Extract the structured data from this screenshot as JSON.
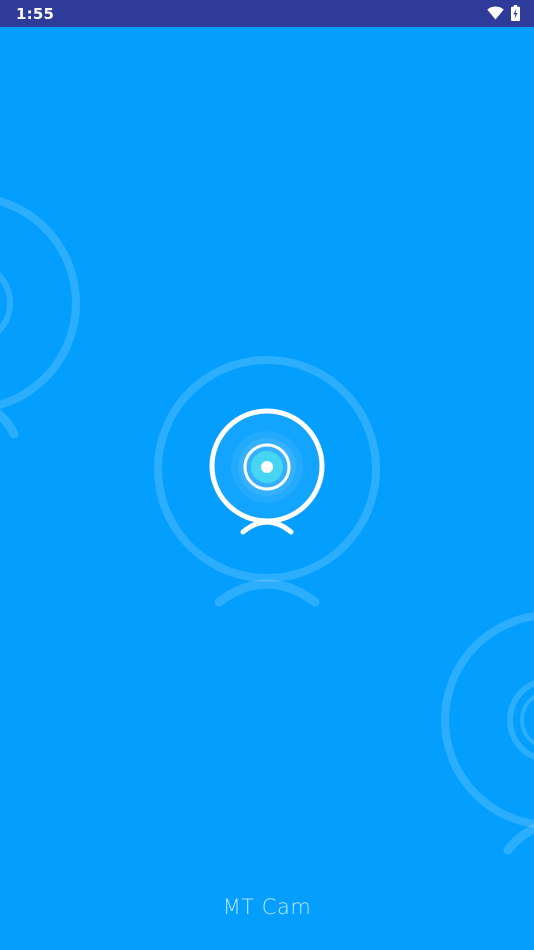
{
  "status_bar": {
    "time": "1:55",
    "icons": [
      "wifi-icon",
      "battery-charging-icon"
    ]
  },
  "splash": {
    "logo_icon": "webcam-icon",
    "app_name": "MT Cam"
  },
  "colors": {
    "background": "#049ffe",
    "status_bar": "#2e3b98",
    "logo_stroke": "#ffffff",
    "lens_center": "#47d6f2"
  }
}
